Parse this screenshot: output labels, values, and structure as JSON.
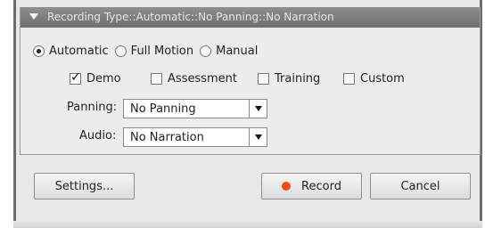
{
  "recording_panel": {
    "header": "Recording Type::Automatic::No Panning::No Narration",
    "modes": [
      {
        "label": "Automatic",
        "selected": true
      },
      {
        "label": "Full Motion",
        "selected": false
      },
      {
        "label": "Manual",
        "selected": false
      }
    ],
    "types": [
      {
        "label": "Demo",
        "checked": true
      },
      {
        "label": "Assessment",
        "checked": false
      },
      {
        "label": "Training",
        "checked": false
      },
      {
        "label": "Custom",
        "checked": false
      }
    ],
    "panning": {
      "label": "Panning:",
      "value": "No Panning"
    },
    "audio": {
      "label": "Audio:",
      "value": "No Narration"
    }
  },
  "footer": {
    "settings_label": "Settings...",
    "record_label": "Record",
    "cancel_label": "Cancel"
  },
  "colors": {
    "header_bg": "#7d7d7d",
    "record_dot": "#f04b1c",
    "dialog_bg": "#e8e8e8"
  }
}
